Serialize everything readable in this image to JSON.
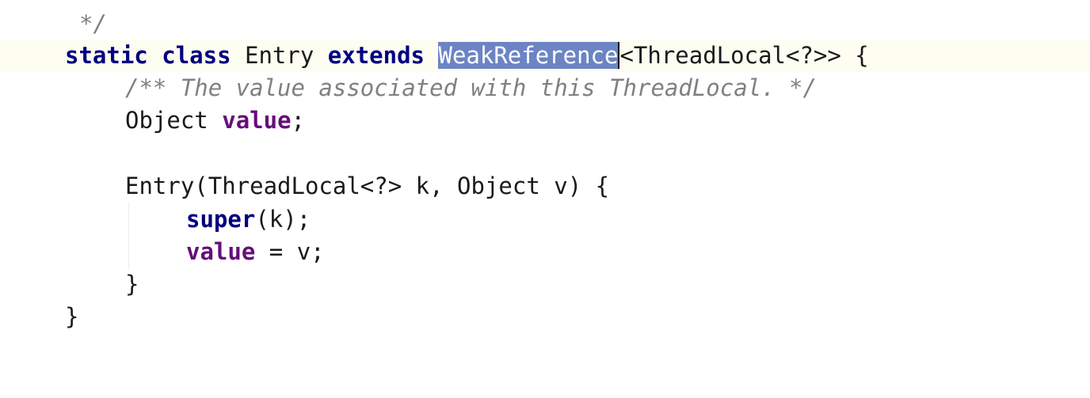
{
  "lines": {
    "l1": {
      "comment": "*/"
    },
    "l2": {
      "kw_static": "static",
      "kw_class": "class",
      "class_name": "Entry",
      "kw_extends": "extends",
      "selected_type": "WeakReference",
      "rest": "<ThreadLocal<?>> {"
    },
    "l3": {
      "comment": "/** The value associated with this ThreadLocal. */"
    },
    "l4": {
      "type": "Object",
      "field": "value",
      "semicolon": ";"
    },
    "l6": {
      "text": "Entry(ThreadLocal<?> k, Object v) {"
    },
    "l7": {
      "kw_super": "super",
      "args": "(k);"
    },
    "l8": {
      "field": "value",
      "rest": " = v;"
    },
    "l9": {
      "brace": "}"
    },
    "l10": {
      "brace": "}"
    }
  }
}
